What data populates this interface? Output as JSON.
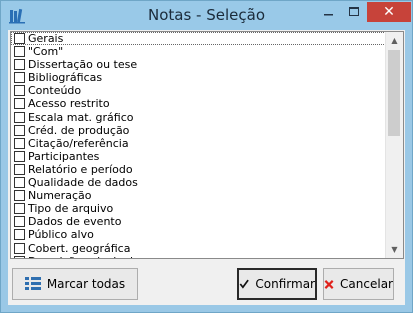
{
  "window": {
    "title": "Notas - Seleção",
    "close_glyph": "✕",
    "minimize_glyph": "—",
    "maximize_glyph": "☐"
  },
  "list": {
    "items": [
      {
        "label": "Gerais",
        "checked": false
      },
      {
        "label": "\"Com\"",
        "checked": false
      },
      {
        "label": "Dissertação ou tese",
        "checked": false
      },
      {
        "label": "Bibliográficas",
        "checked": false
      },
      {
        "label": "Conteúdo",
        "checked": false
      },
      {
        "label": "Acesso restrito",
        "checked": false
      },
      {
        "label": "Escala mat. gráfico",
        "checked": false
      },
      {
        "label": "Créd. de produção",
        "checked": false
      },
      {
        "label": "Citação/referência",
        "checked": false
      },
      {
        "label": "Participantes",
        "checked": false
      },
      {
        "label": "Relatório e período",
        "checked": false
      },
      {
        "label": "Qualidade de dados",
        "checked": false
      },
      {
        "label": "Numeração",
        "checked": false
      },
      {
        "label": "Tipo de arquivo",
        "checked": false
      },
      {
        "label": "Dados de evento",
        "checked": false
      },
      {
        "label": "Público alvo",
        "checked": false
      },
      {
        "label": "Cobert. geográfica",
        "checked": false
      },
      {
        "label": "Descrição principal",
        "checked": false
      }
    ]
  },
  "buttons": {
    "select_all": "Marcar todas",
    "confirm": "Confirmar",
    "cancel": "Cancelar"
  },
  "colors": {
    "titlebar": "#99c9e8",
    "close": "#c7433a",
    "confirm_check": "#111111",
    "cancel_x": "#e0211b",
    "select_all_icon": "#2f6fb0"
  }
}
